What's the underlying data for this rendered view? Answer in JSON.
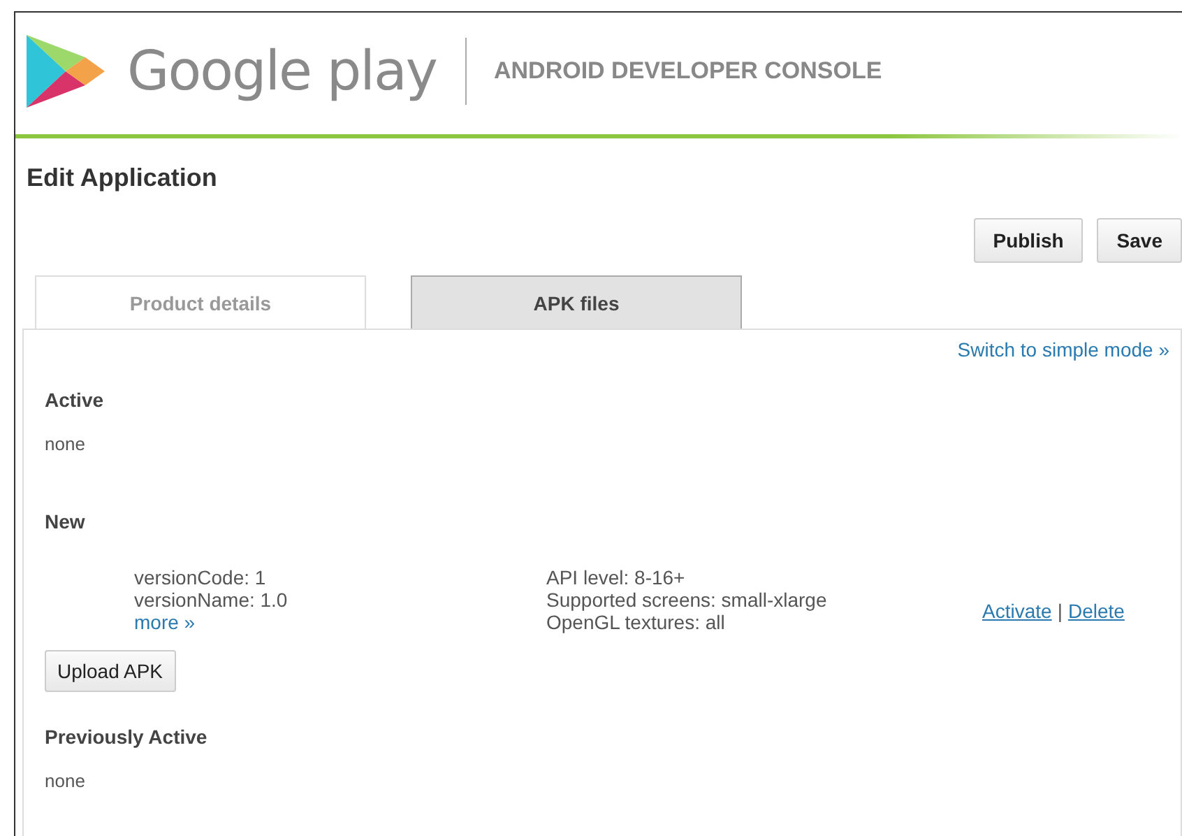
{
  "header": {
    "brand": "Google play",
    "product": "ANDROID DEVELOPER CONSOLE"
  },
  "page_title": "Edit Application",
  "buttons": [
    "Publish",
    "Save"
  ],
  "tabs": [
    {
      "label": "Product details",
      "selected": false
    },
    {
      "label": "APK files",
      "selected": true
    }
  ],
  "mode_link": "Switch to simple mode »",
  "active": {
    "heading": "Active",
    "value": "none"
  },
  "new": {
    "heading": "New",
    "apk": {
      "details": [
        "versionCode: 1",
        "versionName: 1.0"
      ],
      "more_link": "more »",
      "specs": [
        "API level: 8-16+",
        "Supported screens: small-xlarge",
        "OpenGL textures: all"
      ],
      "actions": [
        "Activate",
        "Delete"
      ],
      "separator": "|"
    }
  },
  "upload_button": "Upload APK",
  "previously_active": {
    "heading": "Previously Active",
    "value": "none"
  }
}
